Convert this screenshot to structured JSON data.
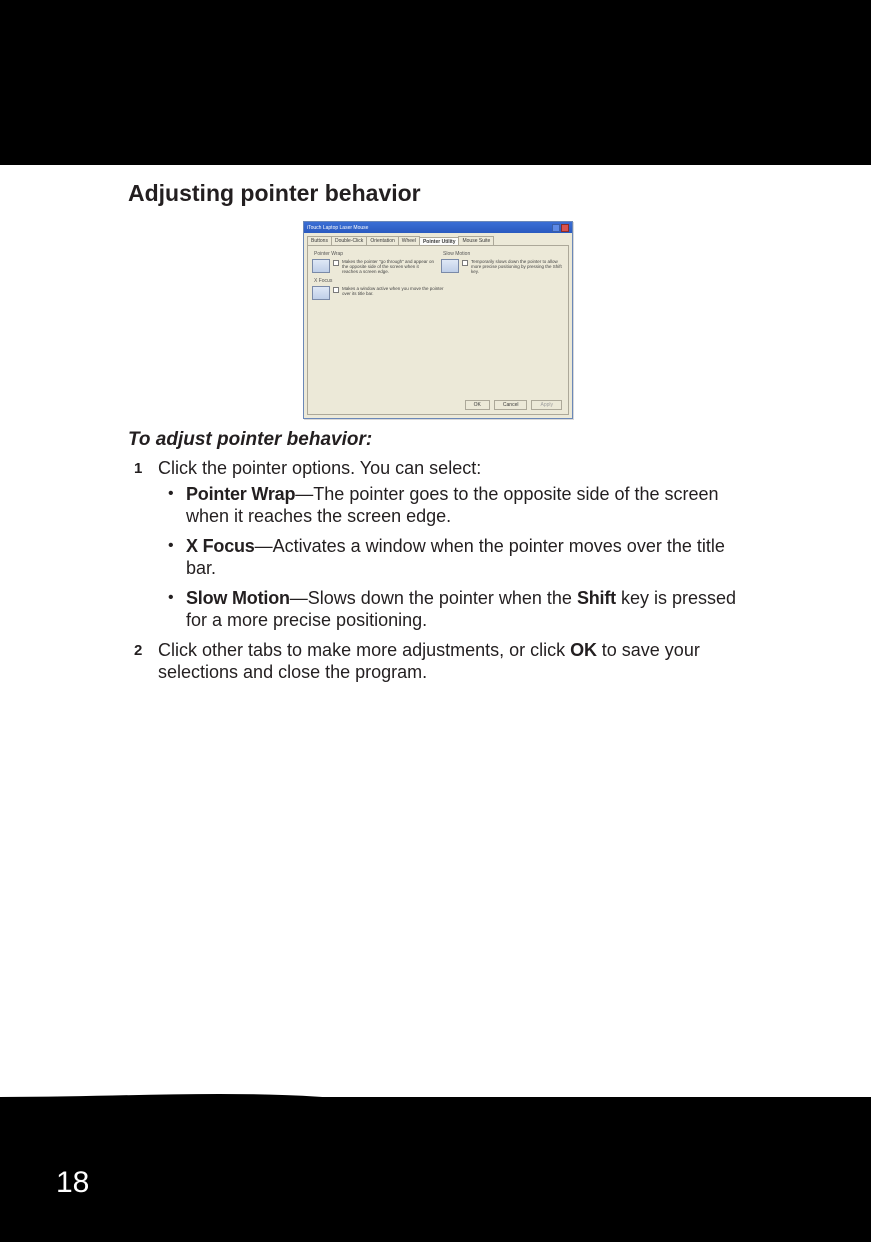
{
  "page_number": "18",
  "section_title": "Adjusting pointer behavior",
  "subhead": "To adjust pointer behavior:",
  "dialog": {
    "title": "iTouch Laptop Laser Mouse",
    "tabs": [
      "Buttons",
      "Double-Click",
      "Orientation",
      "Wheel",
      "Pointer Utility",
      "Mouse Suite"
    ],
    "active_tab_index": 4,
    "groups": {
      "pointer_wrap": {
        "label": "Pointer Wrap",
        "desc": "Makes the pointer \"go through\" and appear on the opposite side of the screen when it reaches a screen edge."
      },
      "slow_motion": {
        "label": "Slow Motion",
        "desc": "Temporarily slows down the pointer to allow more precise positioning by pressing the Shift key."
      },
      "x_focus": {
        "label": "X Focus",
        "desc": "Makes a window active when you move the pointer over its title bar."
      }
    },
    "buttons": {
      "ok": "OK",
      "cancel": "Cancel",
      "apply": "Apply"
    }
  },
  "steps": [
    {
      "text": "Click the pointer options. You can select:",
      "bullets": [
        {
          "term": "Pointer Wrap",
          "desc": "—The pointer goes to the opposite side of the screen when it reaches the screen edge."
        },
        {
          "term": "X Focus",
          "desc": "—Activates a window when the pointer moves over the title bar."
        },
        {
          "term": "Slow Motion",
          "desc_pre": "—Slows down the pointer when the ",
          "key": "Shift",
          "desc_post": " key is pressed for a more precise positioning."
        }
      ]
    },
    {
      "text_pre": "Click other tabs to make more adjustments, or click ",
      "key": "OK",
      "text_post": " to save your selections and close the program."
    }
  ]
}
